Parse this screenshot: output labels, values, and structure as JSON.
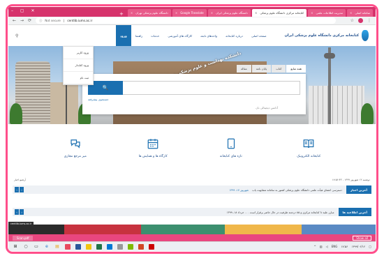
{
  "browser": {
    "tabs": [
      {
        "label": "دانشگاه علوم پزشکی تهران",
        "active": false
      },
      {
        "label": "Google Translate",
        "active": false
      },
      {
        "label": "دانشگاه علوم پزشکی ایران",
        "active": false
      },
      {
        "label": "کتابخانه مرکزی دانشگاه علوم پزشکی",
        "active": true
      },
      {
        "label": "مدیریت اطلاعات علمی",
        "active": false
      },
      {
        "label": "سامانه اصلی",
        "active": false
      }
    ],
    "new_tab_glyph": "+",
    "window_controls": "– ▢ ✕",
    "url_notsecure": "Not secure",
    "url_host": "centlib.iums.ac.ir"
  },
  "site": {
    "title": "کتابخانه مرکزی دانشگاه علوم پزشکی ایران",
    "menu": [
      {
        "label": "صفحه اصلی",
        "active": false
      },
      {
        "label": "درباره کتابخانه",
        "active": false
      },
      {
        "label": "واحدهای تابعه",
        "active": false
      },
      {
        "label": "کارگاه های آموزشی",
        "active": false
      },
      {
        "label": "خدمات",
        "active": false
      },
      {
        "label": "راهنما",
        "active": false
      },
      {
        "label": "ورود",
        "active": true
      }
    ],
    "dropdown": [
      "ورود کاربر",
      "ورود کتابدار",
      "ثبت نام"
    ]
  },
  "hero": {
    "sign_text": "دانشکده بهداشت و علوم پزشکی درمانی ایران"
  },
  "search": {
    "tabs": [
      {
        "label": "همه منابع",
        "active": true
      },
      {
        "label": "کتاب",
        "active": false
      },
      {
        "label": "پایان نامه",
        "active": false
      },
      {
        "label": "مقاله",
        "active": false
      }
    ],
    "button_glyph": "🔍",
    "placeholder": "",
    "advanced_label": "جستجوی پیشرفته",
    "hint": "آدانس دیجیتالی نان"
  },
  "features": [
    {
      "label": "کتابخانه الکترونیک",
      "icon": "book-icon"
    },
    {
      "label": "تازه های کتابخانه",
      "icon": "tablet-icon"
    },
    {
      "label": "کارگاه ها و همایش ها",
      "icon": "calendar-icon"
    },
    {
      "label": "میز مرجع مجازی",
      "icon": "chat-icon"
    }
  ],
  "daterow": {
    "date": "دوشنبه ۱۲ شهریور ۱۳۹۹ - ۱۷:۵۶:۳۲",
    "archive": "آرشیو اخبار"
  },
  "news": {
    "label": "آخرین اخبار",
    "text": "دسترسی اعضای هیأت علمی دانشگاه علوم پزشکی کشور به سامانه مشابهت یاب",
    "date": "شهریور ۱۷، ۱۳۹۹"
  },
  "announcements": {
    "label": "آخرین اطلاعیه ها",
    "text": "مبارز علیه دا کتابخانه مرکزی و ۸۵ دردمند ظرفیت در حال حاضر برقرار است . . . خرداد ۱۸، ۱۳۹۹"
  },
  "strip_colors": [
    "#2b2b2b",
    "#c7323f",
    "#3c8f6f",
    "#f0b74a",
    "#5a8ac4"
  ],
  "sidebar_label": "centlib.iums.ac.ir",
  "download": {
    "file": "Scan.pdf",
    "show_all": "Show all"
  },
  "taskbar": {
    "clock": "۱۷:۵۶",
    "date": "۱۳۹۹/۰۶/۱۲",
    "lang": "ENG"
  },
  "colors": {
    "accent": "#1a6fb0",
    "frame": "#ff4f8b",
    "tabbar": "#d6336c"
  }
}
